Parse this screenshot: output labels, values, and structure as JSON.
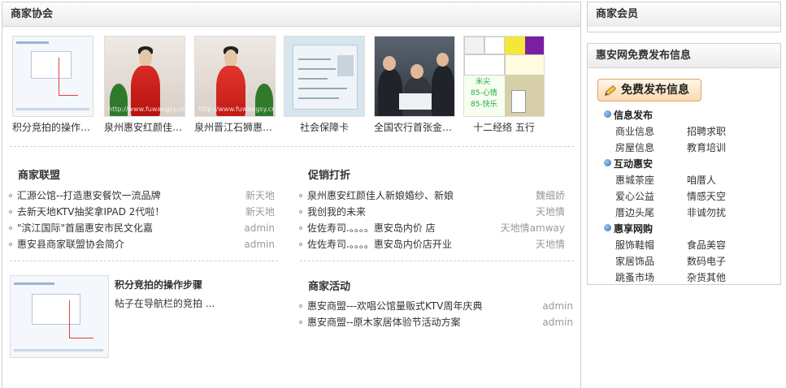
{
  "left_panel": {
    "title": "商家协会",
    "photos": [
      {
        "caption": "积分竞拍的操作步骤"
      },
      {
        "caption": "泉州惠安红颜佳人新娘婚纱"
      },
      {
        "caption": "泉州晋江石狮惠安婚纱"
      },
      {
        "caption": "社会保障卡"
      },
      {
        "caption": "全国农行首张金穗卡"
      },
      {
        "caption": "十二经络 五行"
      }
    ],
    "photo_texts": {
      "watermark": "http://www.fuwangsy.cn",
      "grid_1": "米尖",
      "grid_2": "85-心情",
      "grid_3": "85-快乐"
    },
    "alliance": {
      "title": "商家联盟",
      "items": [
        {
          "title": "汇源公馆--打造惠安餐饮一流品牌",
          "author": "新天地"
        },
        {
          "title": "去新天地KTV抽奖拿IPAD 2代啦！",
          "author": "新天地"
        },
        {
          "title": "\"滨江国际\"首届惠安市民文化嘉",
          "author": "admin"
        },
        {
          "title": "惠安县商家联盟协会简介",
          "author": "admin"
        }
      ]
    },
    "promo": {
      "title": "促销打折",
      "items": [
        {
          "title": "泉州惠安红颜佳人新娘婚纱、新娘",
          "author": "魏细娇"
        },
        {
          "title": "我创我的未来",
          "author": "天地情"
        },
        {
          "title": "佐佐寿司.。。。。惠安岛内价 店",
          "author": "天地情amway"
        },
        {
          "title": "佐佐寿司.。。。。惠安岛内价店开业",
          "author": "天地情"
        }
      ]
    },
    "feature": {
      "title": "积分竞拍的操作步骤",
      "summary": "帖子在导航栏的竞拍 ..."
    },
    "activity": {
      "title": "商家活动",
      "items": [
        {
          "title": "惠安商盟---欢唱公馆量贩式KTV周年庆典",
          "author": "admin"
        },
        {
          "title": "惠安商盟--原木家居体验节活动方案",
          "author": "admin"
        }
      ]
    }
  },
  "members": {
    "title": "商家会员"
  },
  "free_publish": {
    "title": "惠安网免费发布信息",
    "button_label": "免费发布信息",
    "categories": [
      {
        "title": "信息发布",
        "links": [
          "商业信息",
          "招聘求职",
          "房屋信息",
          "教育培训"
        ]
      },
      {
        "title": "互动惠安",
        "links": [
          "惠城茶座",
          "咱厝人",
          "爱心公益",
          "情感天空",
          "厝边头尾",
          "非诚勿扰"
        ]
      },
      {
        "title": "惠享网购",
        "links": [
          "服饰鞋帽",
          "食品美容",
          "家居饰品",
          "数码电子",
          "跳蚤市场",
          "杂货其他"
        ]
      }
    ]
  },
  "colors": {
    "title_text": "#333333",
    "author_text": "#999999",
    "border": "#cfcfcf",
    "button_border": "#e1a26a",
    "category_dot": "#2d74bf"
  }
}
